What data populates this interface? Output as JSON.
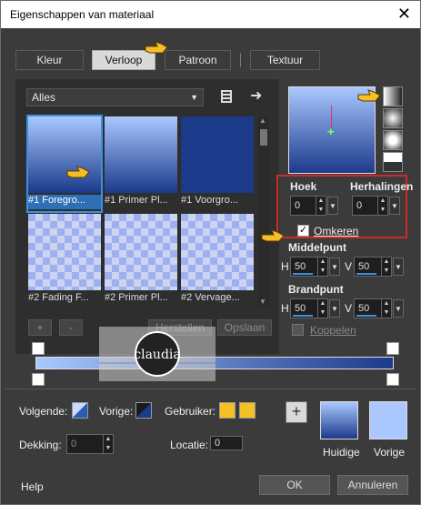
{
  "window": {
    "title": "Eigenschappen van materiaal"
  },
  "tabs": [
    {
      "label": "Kleur"
    },
    {
      "label": "Verloop"
    },
    {
      "label": "Patroon"
    },
    {
      "label": "Textuur"
    }
  ],
  "library": {
    "dropdown": "Alles",
    "items": [
      {
        "label": "#1 Foregro..."
      },
      {
        "label": "#1 Primer Pl..."
      },
      {
        "label": "#1 Voorgro..."
      },
      {
        "label": "#2 Fading F..."
      },
      {
        "label": "#2 Primer Pl..."
      },
      {
        "label": "#2 Vervage..."
      }
    ]
  },
  "buttons": {
    "add": "+",
    "remove": "-",
    "restore": "Herstellen",
    "save": "Opslaan",
    "ok": "OK",
    "cancel": "Annuleren",
    "help": "Help"
  },
  "settings": {
    "angle_label": "Hoek",
    "angle": "0",
    "repeat_label": "Herhalingen",
    "repeat": "0",
    "invert_label": "Omkeren",
    "invert_checked": true,
    "midpoint_label": "Middelpunt",
    "midpoint_h": "50",
    "midpoint_v": "50",
    "focal_label": "Brandpunt",
    "focal_h": "50",
    "focal_v": "50",
    "link_label": "Koppelen",
    "link_checked": false,
    "h": "H",
    "v": "V"
  },
  "editor": {
    "next_label": "Volgende:",
    "prev_label": "Vorige:",
    "user_label": "Gebruiker:",
    "opacity_label": "Dekking:",
    "opacity": "0",
    "location_label": "Locatie:",
    "location": "0"
  },
  "preview": {
    "current_label": "Huidige",
    "previous_label": "Vorige"
  },
  "watermark": {
    "text": "claudia"
  },
  "colors": {
    "accent": "#3d8fe0",
    "gradient_top": "#aac8ff",
    "gradient_bottom": "#1c3a8a",
    "user_color": "#f4c026",
    "highlight": "#cc2b2b"
  },
  "icons": [
    "save-icon",
    "arrow-right-icon",
    "checkmark-icon",
    "plus-icon",
    "hand-pointer-icon",
    "gradient-style-icon"
  ]
}
